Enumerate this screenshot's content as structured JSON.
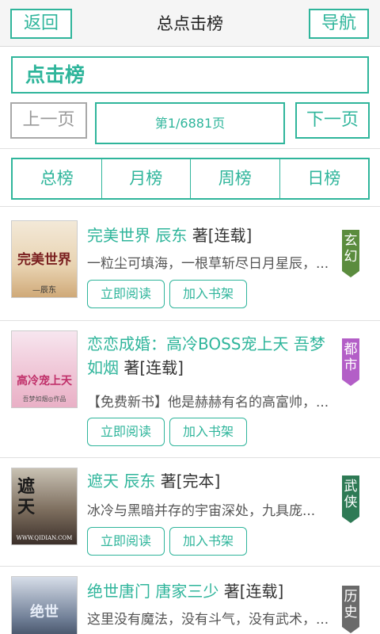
{
  "header": {
    "back": "返回",
    "title": "总点击榜",
    "nav": "导航"
  },
  "rank_title": "点击榜",
  "pager": {
    "prev": "上一页",
    "info": "第1/6881页",
    "next": "下一页"
  },
  "tabs": [
    "总榜",
    "月榜",
    "周榜",
    "日榜"
  ],
  "books": [
    {
      "name": "完美世界",
      "author": "辰东",
      "status": "著[连载]",
      "desc": "一粒尘可填海，一根草斩尽日月星辰，...",
      "genre": "玄幻",
      "genre_color": "#5b8c3e",
      "cover_text": "完美世界",
      "cover_author": "—辰东"
    },
    {
      "name": "恋恋成婚：高冷BOSS宠上天",
      "author": "吾梦",
      "author_tail": "如烟",
      "status": "著[连载]",
      "desc": "【免费新书】他是赫赫有名的高富帅，...",
      "genre": "都市",
      "genre_color": "#b35ec7",
      "cover_text": "高冷宠上天",
      "cover_author": "吾梦如烟◎作品"
    },
    {
      "name": "遮天",
      "author": "辰东",
      "status": "著[完本]",
      "desc": "冰冷与黑暗并存的宇宙深处，九具庞...",
      "genre": "武侠",
      "genre_color": "#2e7a55",
      "cover_text": "遮天",
      "cover_author": "WWW.QIDIAN.COM"
    },
    {
      "name": "绝世唐门",
      "author": "唐家三少",
      "status": "著[连载]",
      "desc": "这里没有魔法，没有斗气，没有武术，...",
      "genre": "历史",
      "genre_color": "#6a6a6a",
      "cover_text": "绝世",
      "cover_author": ""
    }
  ],
  "buttons": {
    "read": "立即阅读",
    "shelf": "加入书架"
  }
}
